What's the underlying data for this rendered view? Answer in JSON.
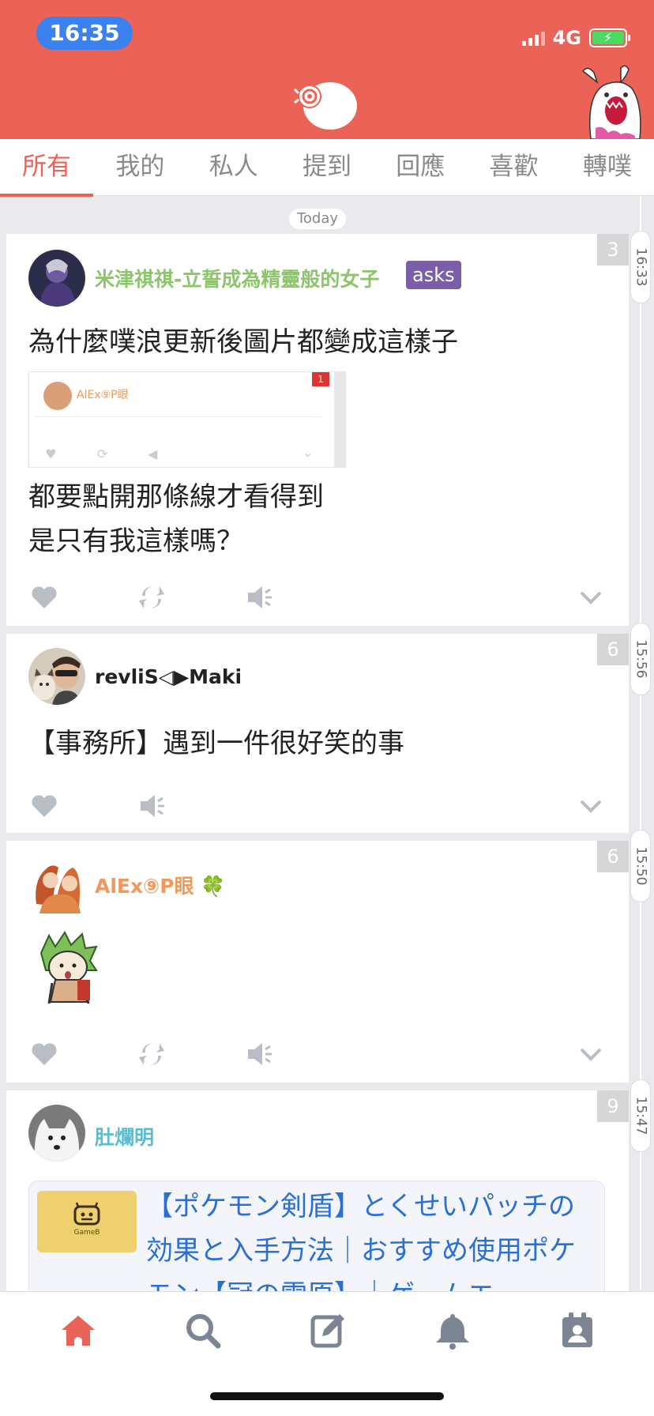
{
  "status_bar": {
    "time": "16:35",
    "network": "4G"
  },
  "colors": {
    "brand": "#eb6356",
    "time_pill": "#3b82f0",
    "asks_badge": "#7a5fa8",
    "link": "#2a6fd6",
    "icon_gray": "#b9bdc6"
  },
  "tabs": [
    {
      "label": "所有",
      "active": true
    },
    {
      "label": "我的",
      "active": false
    },
    {
      "label": "私人",
      "active": false
    },
    {
      "label": "提到",
      "active": false
    },
    {
      "label": "回應",
      "active": false
    },
    {
      "label": "喜歡",
      "active": false
    },
    {
      "label": "轉噗",
      "active": false
    }
  ],
  "timeline": {
    "day_label": "Today"
  },
  "posts": [
    {
      "author": "米津祺祺-立誓成為精靈般的女子",
      "author_color": "#8cc56c",
      "qualifier": "asks",
      "time": "16:33",
      "response_count": "3",
      "content_line1": "為什麼噗浪更新後圖片都變成這樣子",
      "content_line2": "都要點開那條線才看得到",
      "content_line3": "是只有我這樣嗎？",
      "embedded_screenshot": {
        "author": "AlEx⑨P眼",
        "count": "1"
      },
      "actions": [
        "heart-icon",
        "replurk-icon",
        "mute-icon",
        "chevron-down-icon"
      ]
    },
    {
      "author": "revliS◁▶Maki",
      "author_color": "#222222",
      "time": "15:56",
      "response_count": "6",
      "content_line1": "【事務所】遇到一件很好笑的事",
      "actions": [
        "heart-icon",
        "mute-icon",
        "chevron-down-icon"
      ]
    },
    {
      "author": "AlEx⑨P眼",
      "author_color": "#f2985a",
      "author_emoji": "🍀",
      "time": "15:50",
      "response_count": "6",
      "actions": [
        "heart-icon",
        "replurk-icon",
        "mute-icon",
        "chevron-down-icon"
      ]
    },
    {
      "author": "肚爛明",
      "author_color": "#5bbdd0",
      "time": "15:47",
      "response_count": "9",
      "link_preview": {
        "thumb_label": "GameB",
        "title": "【ポケモン剣盾】とくせいパッチの効果と入手方法｜おすすめ使用ポケモン【冠の雪原】｜ゲームエ"
      }
    }
  ],
  "bottom_nav": [
    "home-icon",
    "search-icon",
    "compose-icon",
    "bell-icon",
    "profile-icon"
  ]
}
